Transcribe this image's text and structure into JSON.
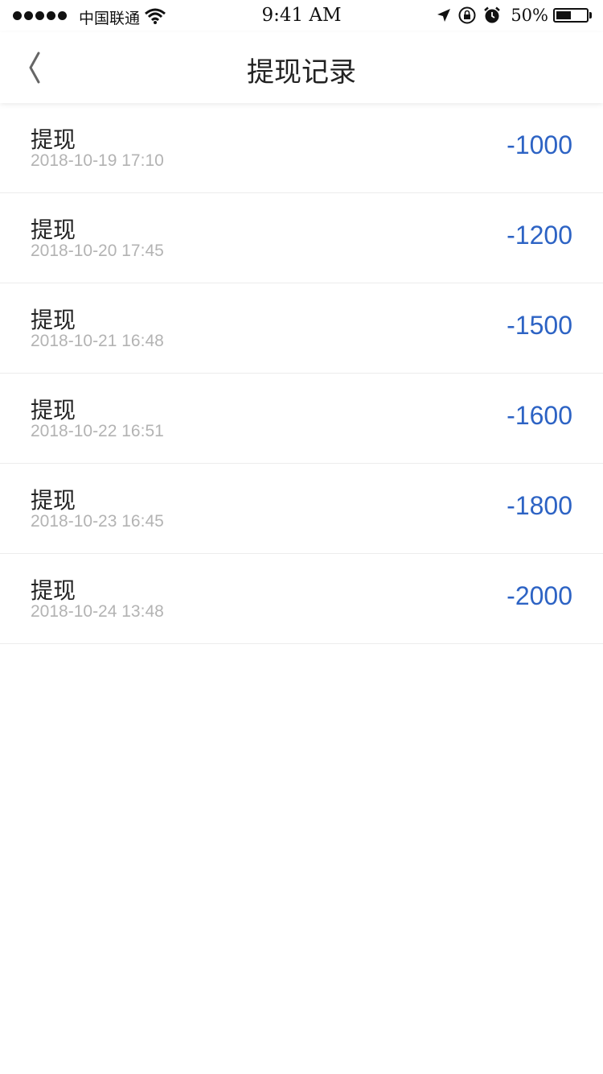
{
  "status_bar": {
    "carrier": "中国联通",
    "time": "9:41 AM",
    "battery_percent": "50%",
    "battery_level": 0.5
  },
  "nav": {
    "title": "提现记录",
    "back_icon": "chevron-left-icon"
  },
  "records": [
    {
      "type": "提现",
      "time": "2018-10-19 17:10",
      "amount": "-1000"
    },
    {
      "type": "提现",
      "time": "2018-10-20 17:45",
      "amount": "-1200"
    },
    {
      "type": "提现",
      "time": "2018-10-21 16:48",
      "amount": "-1500"
    },
    {
      "type": "提现",
      "time": "2018-10-22 16:51",
      "amount": "-1600"
    },
    {
      "type": "提现",
      "time": "2018-10-23 16:45",
      "amount": "-1800"
    },
    {
      "type": "提现",
      "time": "2018-10-24 13:48",
      "amount": "-2000"
    }
  ],
  "colors": {
    "amount": "#2d63c4",
    "time_text": "#b3b3b3",
    "title_text": "#222222"
  }
}
